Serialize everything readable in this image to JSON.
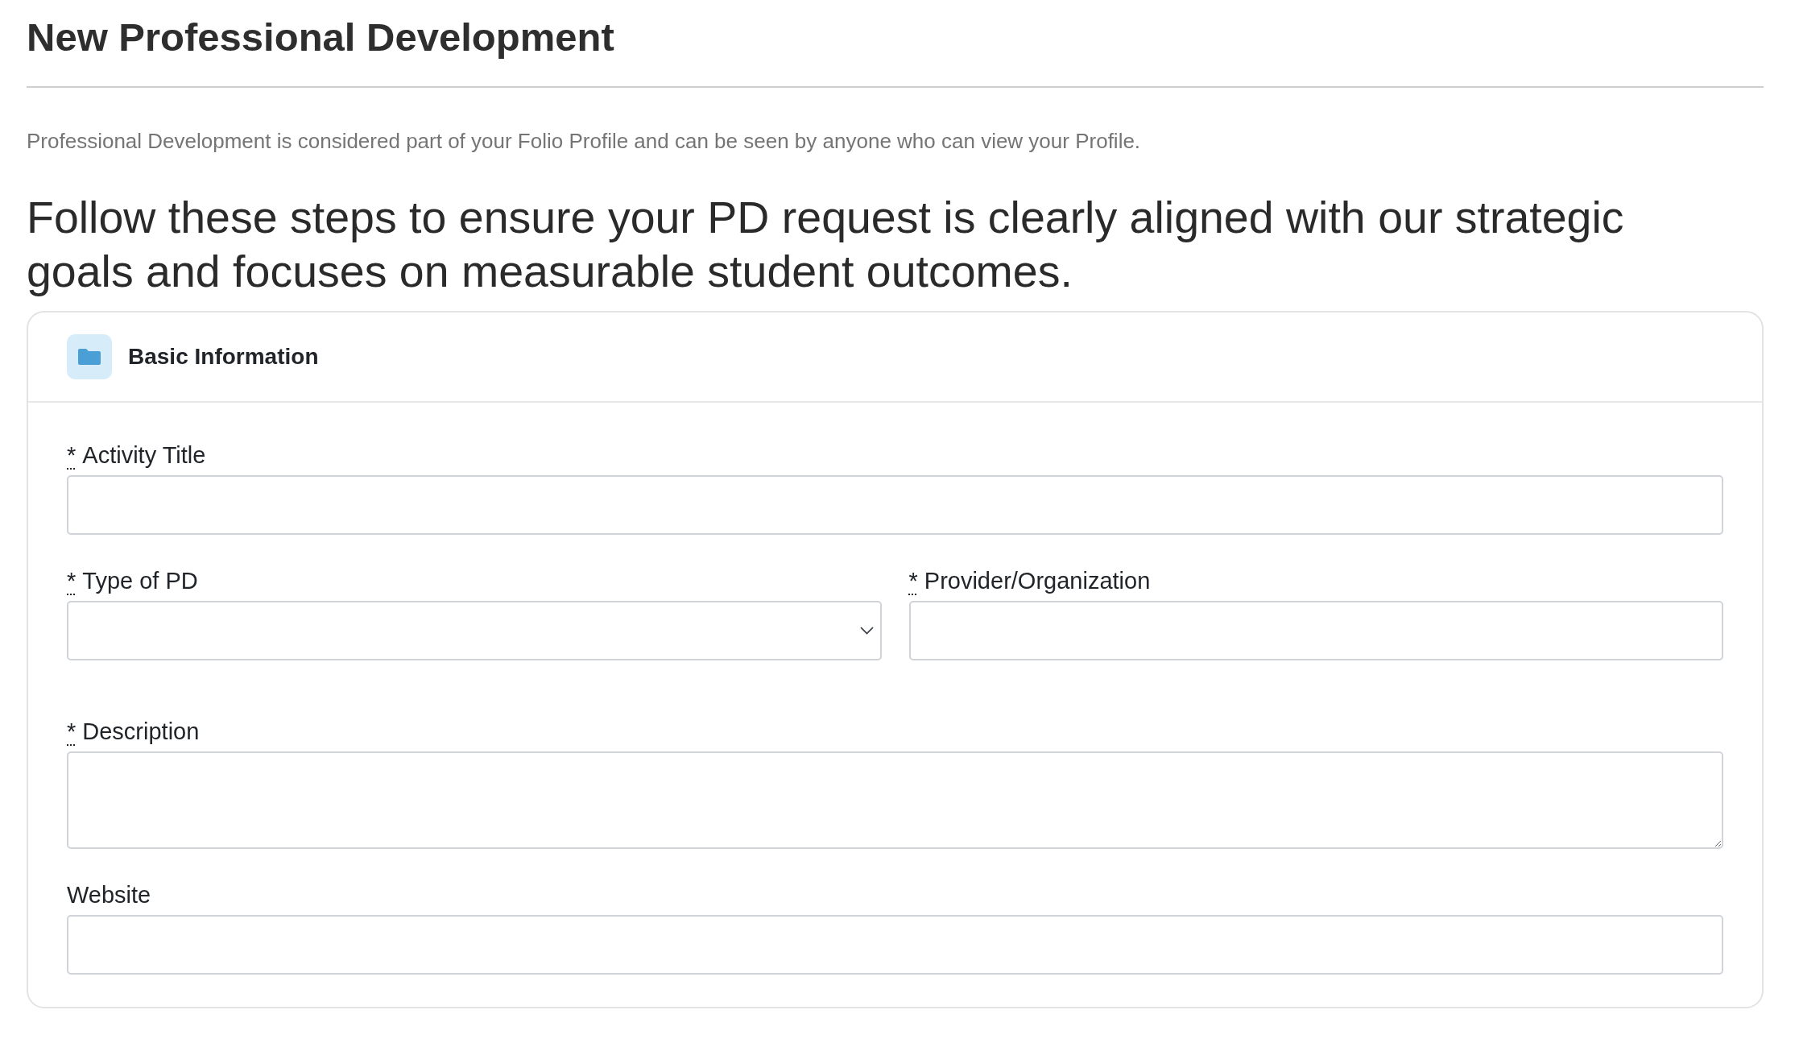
{
  "page_title": "New Professional Development",
  "notice": "Professional Development is considered part of your Folio Profile and can be seen by anyone who can view your Profile.",
  "intro": "Follow these steps to ensure your PD request is clearly aligned with our strategic goals and focuses on measurable student outcomes.",
  "section": {
    "title": "Basic Information",
    "rows": [
      {
        "fields": [
          {
            "kind": "text",
            "label": "Activity Title",
            "required_mark": "*"
          }
        ]
      },
      {
        "fields": [
          {
            "kind": "select",
            "label": "Type of PD",
            "required_mark": "*"
          },
          {
            "kind": "text",
            "label": "Provider/Organization",
            "required_mark": "*"
          }
        ]
      },
      {
        "fields": [
          {
            "kind": "textarea",
            "label": "Description",
            "required_mark": "*"
          }
        ]
      },
      {
        "fields": [
          {
            "kind": "text",
            "label": "Website"
          }
        ]
      }
    ]
  }
}
